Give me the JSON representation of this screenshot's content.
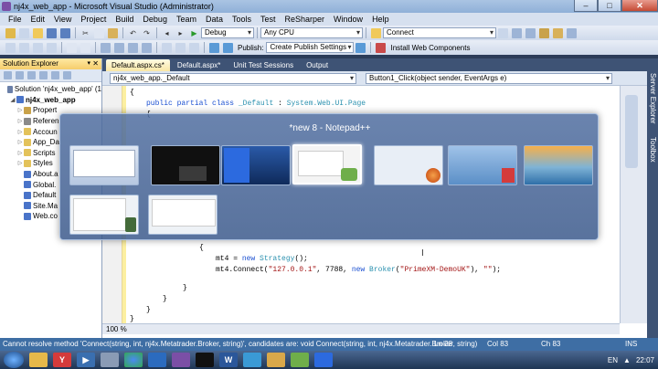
{
  "window": {
    "title": "nj4x_web_app - Microsoft Visual Studio (Administrator)",
    "minimize": "–",
    "maximize": "□",
    "close": "✕"
  },
  "menu": [
    "File",
    "Edit",
    "View",
    "Project",
    "Build",
    "Debug",
    "Team",
    "Data",
    "Tools",
    "Test",
    "ReSharper",
    "Window",
    "Help"
  ],
  "toolbar1": {
    "config": "Debug",
    "platform": "Any CPU",
    "connect": "Connect"
  },
  "toolbar2": {
    "publish_label": "Publish:",
    "publish_settings": "Create Publish Settings",
    "install_label": "Install Web Components"
  },
  "solution_explorer": {
    "header": "Solution Explorer",
    "items": [
      {
        "label": "Solution 'nj4x_web_app' (1",
        "indent": 0,
        "bold": false,
        "color": "#6a7fa8"
      },
      {
        "label": "nj4x_web_app",
        "indent": 1,
        "bold": true,
        "color": "#4a74c9"
      },
      {
        "label": "Propert",
        "indent": 2,
        "bold": false,
        "color": "#c9a24a"
      },
      {
        "label": "Referen",
        "indent": 2,
        "bold": false,
        "color": "#8a8a8a"
      },
      {
        "label": "Accoun",
        "indent": 2,
        "bold": false,
        "color": "#e3c25a"
      },
      {
        "label": "App_Da",
        "indent": 2,
        "bold": false,
        "color": "#e3c25a"
      },
      {
        "label": "Scripts",
        "indent": 2,
        "bold": false,
        "color": "#e3c25a"
      },
      {
        "label": "Styles",
        "indent": 2,
        "bold": false,
        "color": "#e3c25a"
      },
      {
        "label": "About.a",
        "indent": 2,
        "bold": false,
        "color": "#4a74c9"
      },
      {
        "label": "Global.",
        "indent": 2,
        "bold": false,
        "color": "#4a74c9"
      },
      {
        "label": "Default",
        "indent": 2,
        "bold": false,
        "color": "#4a74c9"
      },
      {
        "label": "Site.Ma",
        "indent": 2,
        "bold": false,
        "color": "#4a74c9"
      },
      {
        "label": "Web.co",
        "indent": 2,
        "bold": false,
        "color": "#4a74c9"
      }
    ]
  },
  "tabs": [
    {
      "label": "Default.aspx.cs*",
      "active": true
    },
    {
      "label": "Default.aspx*",
      "active": false
    },
    {
      "label": "Unit Test Sessions",
      "active": false
    },
    {
      "label": "Output",
      "active": false
    }
  ],
  "nav": {
    "left": "nj4x_web_app._Default",
    "right": "Button1_Click(object sender, EventArgs e)"
  },
  "code": {
    "line_open_brace": "{",
    "class_decl": {
      "kw1": "public",
      "kw2": "partial",
      "kw3": "class",
      "name": "_Default",
      "sep": " : ",
      "base": "System.Web.UI.Page"
    },
    "brace_inner": "{",
    "mt4_new": {
      "pre": "mt4 = ",
      "kw": "new",
      "type": "Strategy",
      "post": "();"
    },
    "mt4_connect": {
      "pre": "mt4.Connect(",
      "s1": "\"127.0.0.1\"",
      "mid": ", 7788, ",
      "kw": "new",
      "type": "Broker",
      "paren": "(",
      "s2": "\"PrimeXM-DemoUK\"",
      "mid2": "), ",
      "s3": "\"\"",
      "post": ");"
    },
    "close1": "}",
    "close2": "}",
    "close3": "}",
    "close4": "}"
  },
  "zoom": "100 %",
  "right_strip": [
    "Server Explorer",
    "Toolbox"
  ],
  "switcher": {
    "title": "*new  8 - Notepad++"
  },
  "status": {
    "message": "Cannot resolve method 'Connect(string, int, nj4x.Metatrader.Broker, string)', candidates are:  void Connect(string, int, nj4x.Metatrader.Broker, string)",
    "ln": "Ln 28",
    "col": "Col 83",
    "ch": "Ch 83",
    "ins": "INS"
  },
  "taskbar": {
    "lang": "EN",
    "time": "22:07"
  }
}
